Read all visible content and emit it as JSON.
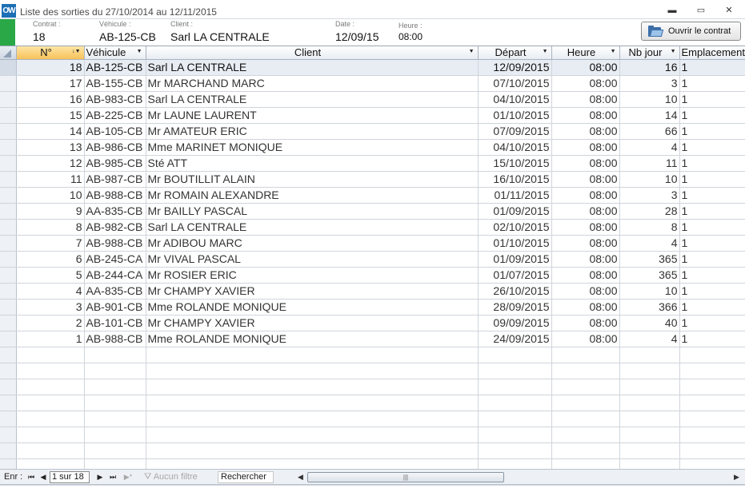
{
  "window": {
    "title": "Liste des sorties du 27/10/2014 au 12/11/2015",
    "logo": "OW",
    "minimize_glyph": "▬",
    "maximize_glyph": "▭",
    "close_glyph": "✕"
  },
  "header": {
    "contrat_label": "Contrat :",
    "contrat_value": "18",
    "vehicule_label": "Véhicule :",
    "vehicule_value": "AB-125-CB",
    "client_label": "Client :",
    "client_value": "Sarl LA CENTRALE",
    "date_label": "Date :",
    "date_value": "12/09/15",
    "heure_label": "Heure :",
    "heure_value": "08:00",
    "open_button_label": "Ouvrir le contrat",
    "accent_color": "#2aa848"
  },
  "grid": {
    "columns": [
      "N°",
      "Véhicule",
      "Client",
      "Départ",
      "Heure",
      "Nb jour",
      "Emplacement"
    ],
    "rows": [
      {
        "num": "18",
        "vehicule": "AB-125-CB",
        "client": "Sarl LA CENTRALE",
        "depart": "12/09/2015",
        "heure": "08:00",
        "nb_jour": "16",
        "emplacement": "1"
      },
      {
        "num": "17",
        "vehicule": "AB-155-CB",
        "client": "Mr MARCHAND MARC",
        "depart": "07/10/2015",
        "heure": "08:00",
        "nb_jour": "3",
        "emplacement": "1"
      },
      {
        "num": "16",
        "vehicule": "AB-983-CB",
        "client": "Sarl LA CENTRALE",
        "depart": "04/10/2015",
        "heure": "08:00",
        "nb_jour": "10",
        "emplacement": "1"
      },
      {
        "num": "15",
        "vehicule": "AB-225-CB",
        "client": "Mr LAUNE LAURENT",
        "depart": "01/10/2015",
        "heure": "08:00",
        "nb_jour": "14",
        "emplacement": "1"
      },
      {
        "num": "14",
        "vehicule": "AB-105-CB",
        "client": "Mr AMATEUR ERIC",
        "depart": "07/09/2015",
        "heure": "08:00",
        "nb_jour": "66",
        "emplacement": "1"
      },
      {
        "num": "13",
        "vehicule": "AB-986-CB",
        "client": "Mme MARINET MONIQUE",
        "depart": "04/10/2015",
        "heure": "08:00",
        "nb_jour": "4",
        "emplacement": "1"
      },
      {
        "num": "12",
        "vehicule": "AB-985-CB",
        "client": "Sté ATT",
        "depart": "15/10/2015",
        "heure": "08:00",
        "nb_jour": "11",
        "emplacement": "1"
      },
      {
        "num": "11",
        "vehicule": "AB-987-CB",
        "client": "Mr BOUTILLIT ALAIN",
        "depart": "16/10/2015",
        "heure": "08:00",
        "nb_jour": "10",
        "emplacement": "1"
      },
      {
        "num": "10",
        "vehicule": "AB-988-CB",
        "client": "Mr ROMAIN ALEXANDRE",
        "depart": "01/11/2015",
        "heure": "08:00",
        "nb_jour": "3",
        "emplacement": "1"
      },
      {
        "num": "9",
        "vehicule": "AA-835-CB",
        "client": "Mr BAILLY PASCAL",
        "depart": "01/09/2015",
        "heure": "08:00",
        "nb_jour": "28",
        "emplacement": "1"
      },
      {
        "num": "8",
        "vehicule": "AB-982-CB",
        "client": "Sarl LA CENTRALE",
        "depart": "02/10/2015",
        "heure": "08:00",
        "nb_jour": "8",
        "emplacement": "1"
      },
      {
        "num": "7",
        "vehicule": "AB-988-CB",
        "client": "Mr ADIBOU MARC",
        "depart": "01/10/2015",
        "heure": "08:00",
        "nb_jour": "4",
        "emplacement": "1"
      },
      {
        "num": "6",
        "vehicule": "AB-245-CA",
        "client": "Mr VIVAL PASCAL",
        "depart": "01/09/2015",
        "heure": "08:00",
        "nb_jour": "365",
        "emplacement": "1"
      },
      {
        "num": "5",
        "vehicule": "AB-244-CA",
        "client": "Mr ROSIER ERIC",
        "depart": "01/07/2015",
        "heure": "08:00",
        "nb_jour": "365",
        "emplacement": "1"
      },
      {
        "num": "4",
        "vehicule": "AA-835-CB",
        "client": "Mr CHAMPY XAVIER",
        "depart": "26/10/2015",
        "heure": "08:00",
        "nb_jour": "10",
        "emplacement": "1"
      },
      {
        "num": "3",
        "vehicule": "AB-901-CB",
        "client": "Mme ROLANDE MONIQUE",
        "depart": "28/09/2015",
        "heure": "08:00",
        "nb_jour": "366",
        "emplacement": "1"
      },
      {
        "num": "2",
        "vehicule": "AB-101-CB",
        "client": "Mr CHAMPY XAVIER",
        "depart": "09/09/2015",
        "heure": "08:00",
        "nb_jour": "40",
        "emplacement": "1"
      },
      {
        "num": "1",
        "vehicule": "AB-988-CB",
        "client": "Mme ROLANDE MONIQUE",
        "depart": "24/09/2015",
        "heure": "08:00",
        "nb_jour": "4",
        "emplacement": "1"
      }
    ]
  },
  "navigation": {
    "record_label": "Enr :",
    "record_value": "1 sur 18",
    "filter_label": "Aucun filtre",
    "search_label": "Rechercher",
    "first_glyph": "⏮",
    "prev_glyph": "◀",
    "next_glyph": "▶",
    "last_glyph": "⏭",
    "new_glyph": "▶*",
    "filter_icon_glyph": "⛛",
    "scroll_left_glyph": "◀",
    "scroll_right_glyph": "▶",
    "scroll_grip_glyph": "|||"
  }
}
